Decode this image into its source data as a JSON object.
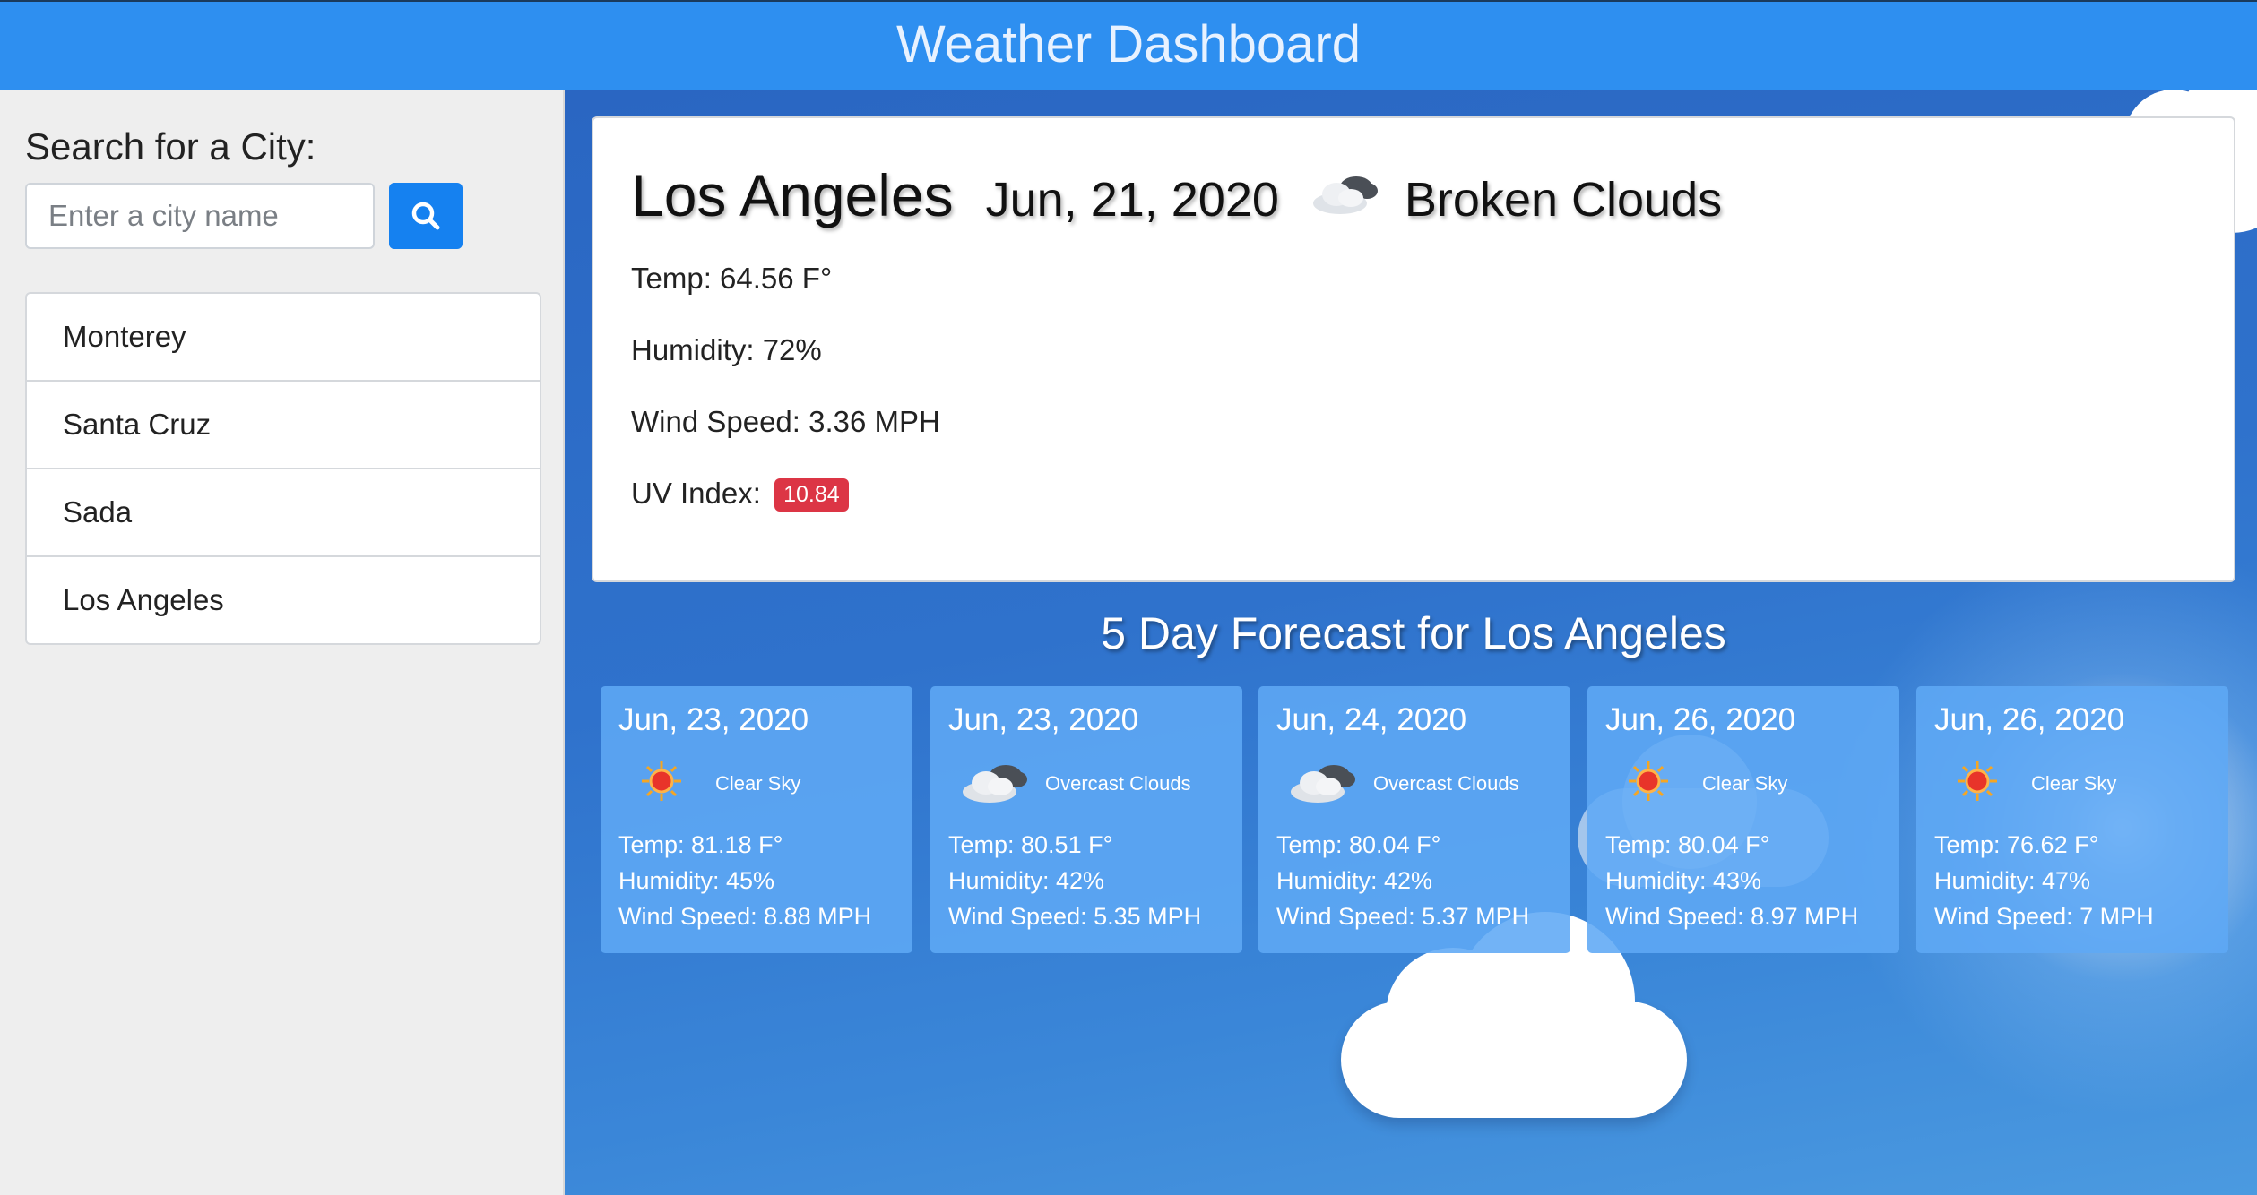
{
  "header": {
    "title": "Weather Dashboard"
  },
  "sidebar": {
    "search_label": "Search for a City:",
    "search_placeholder": "Enter a city name",
    "search_button_icon": "search-icon",
    "cities": [
      {
        "label": "Monterey"
      },
      {
        "label": "Santa Cruz"
      },
      {
        "label": "Sada"
      },
      {
        "label": "Los Angeles"
      }
    ]
  },
  "current": {
    "city": "Los Angeles",
    "date": "Jun, 21, 2020",
    "icon": "broken-clouds-icon",
    "description": "Broken Clouds",
    "temp": "Temp: 64.56 F°",
    "humidity": "Humidity: 72%",
    "wind": "Wind Speed: 3.36 MPH",
    "uv_label": "UV Index:",
    "uv_value": "10.84",
    "uv_color": "#dc3545"
  },
  "forecast": {
    "heading": "5 Day Forecast for Los Angeles",
    "days": [
      {
        "date": "Jun, 23, 2020",
        "icon": "sun-icon",
        "description": "Clear Sky",
        "temp": "Temp: 81.18 F°",
        "humidity": "Humidity: 45%",
        "wind": "Wind Speed: 8.88 MPH"
      },
      {
        "date": "Jun, 23, 2020",
        "icon": "overcast-clouds-icon",
        "description": "Overcast Clouds",
        "temp": "Temp: 80.51 F°",
        "humidity": "Humidity: 42%",
        "wind": "Wind Speed: 5.35 MPH"
      },
      {
        "date": "Jun, 24, 2020",
        "icon": "overcast-clouds-icon",
        "description": "Overcast Clouds",
        "temp": "Temp: 80.04 F°",
        "humidity": "Humidity: 42%",
        "wind": "Wind Speed: 5.37 MPH"
      },
      {
        "date": "Jun, 26, 2020",
        "icon": "sun-icon",
        "description": "Clear Sky",
        "temp": "Temp: 80.04 F°",
        "humidity": "Humidity: 43%",
        "wind": "Wind Speed: 8.97 MPH"
      },
      {
        "date": "Jun, 26, 2020",
        "icon": "sun-icon",
        "description": "Clear Sky",
        "temp": "Temp: 76.62 F°",
        "humidity": "Humidity: 47%",
        "wind": "Wind Speed: 7 MPH"
      }
    ]
  },
  "colors": {
    "header_bg": "#2e8ff0",
    "accent_button": "#1581f0",
    "sidebar_bg": "#eeeeee",
    "sky": "#2f72cc",
    "forecast_card": "#5fa8f5"
  }
}
